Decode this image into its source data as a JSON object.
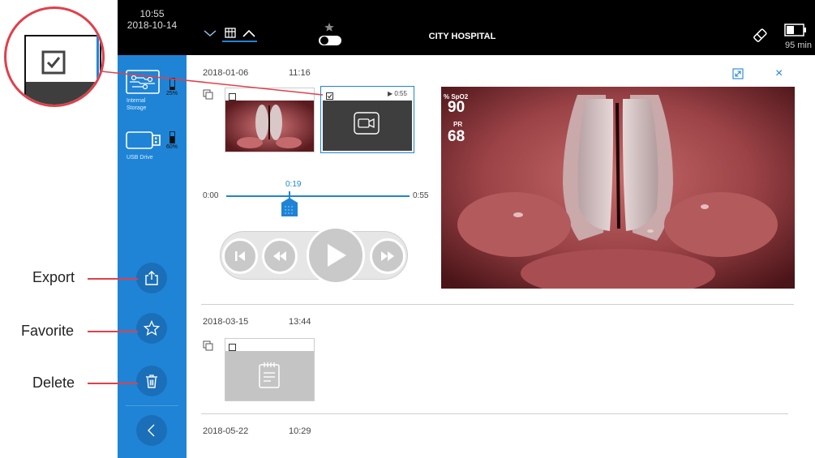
{
  "header": {
    "time": "10:55",
    "date": "2018-10-14",
    "hospital": "CITY HOSPITAL",
    "battery_time": "95 min"
  },
  "sidebar": {
    "storage": [
      {
        "label_line1": "Internal",
        "label_line2": "Storage",
        "percent": "25%"
      },
      {
        "label_line1": "USB Drive",
        "label_line2": "",
        "percent": "60%"
      }
    ]
  },
  "callouts": {
    "export": "Export",
    "favorite": "Favorite",
    "delete": "Delete"
  },
  "records": [
    {
      "date": "2018-01-06",
      "time": "11:16"
    },
    {
      "date": "2018-03-15",
      "time": "13:44"
    },
    {
      "date": "2018-05-22",
      "time": "10:29"
    }
  ],
  "video_thumb": {
    "duration": "0:55"
  },
  "player": {
    "start": "0:00",
    "current": "0:19",
    "end": "0:55",
    "progress": 0.345
  },
  "vitals": {
    "spo2_label": "% SpO2",
    "spo2_value": "90",
    "pr_label": "PR",
    "pr_value": "68"
  },
  "colors": {
    "sidebar": "#1f84d6",
    "accent": "#1f84d6",
    "callout": "#e0404a",
    "topbar": "#000000"
  }
}
